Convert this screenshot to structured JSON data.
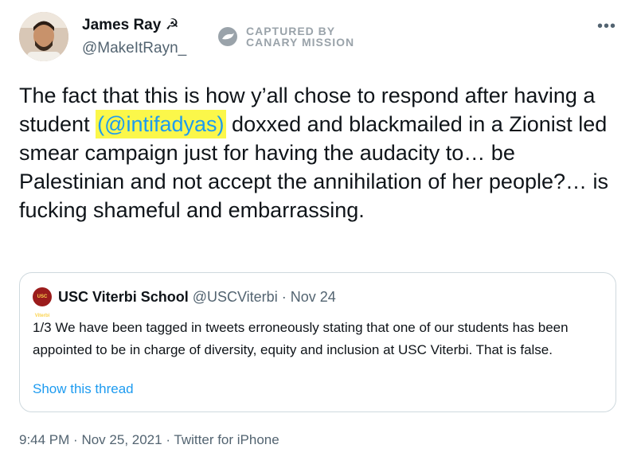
{
  "author": {
    "display_name": "James Ray",
    "name_emoji": "☭",
    "handle": "@MakeItRayn_",
    "avatar": "avatar-photo"
  },
  "watermark": {
    "line1": "CAPTURED BY",
    "line2": "CANARY MISSION",
    "icon": "canary-bird-icon"
  },
  "more_icon": "more-options-icon",
  "tweet": {
    "text_before": "The fact that this is how y’all chose to respond after having a student ",
    "mention": "(@intifadyas)",
    "text_after": " doxxed and blackmailed in a Zionist led smear campaign just for having the audacity to… be Palestinian and not accept the annihilation of her people?… is fucking shameful and embarrassing."
  },
  "quote": {
    "avatar_label": "USC Viterbi",
    "name": "USC Viterbi School",
    "handle": "@USCViterbi",
    "separator": "·",
    "date": "Nov 24",
    "text": "1/3 We have been tagged in tweets erroneously stating that one of our students has been appointed to be in charge of diversity, equity and inclusion at USC Viterbi. That is false.",
    "link": "Show this thread"
  },
  "meta": {
    "time": "9:44 PM",
    "separator": "·",
    "date": "Nov 25, 2021",
    "source": "Twitter for iPhone"
  },
  "colors": {
    "link": "#1d9bf0",
    "highlight": "#fbf74a",
    "secondary_text": "#536471",
    "border": "#cfd9de"
  }
}
